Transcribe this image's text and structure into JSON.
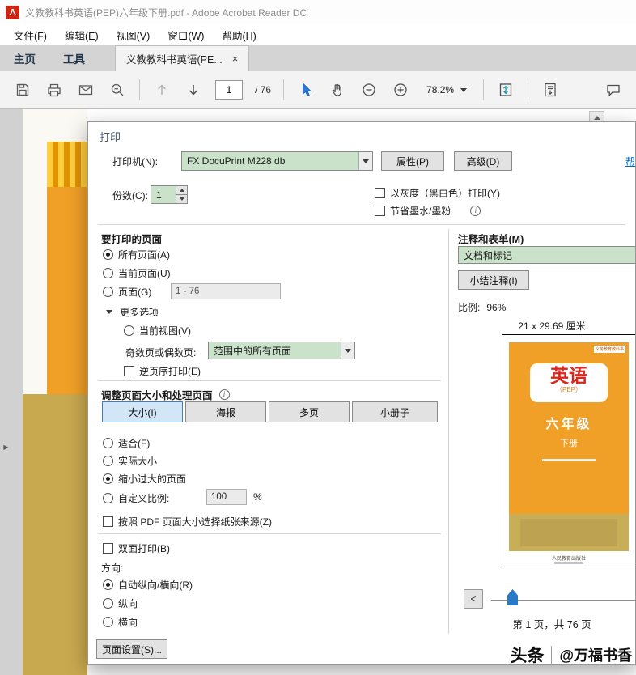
{
  "title_bar": {
    "app_title": "义教教科书英语(PEP)六年级下册.pdf - Adobe Acrobat Reader DC"
  },
  "menu_bar": {
    "items": [
      "文件(F)",
      "编辑(E)",
      "视图(V)",
      "窗口(W)",
      "帮助(H)"
    ]
  },
  "tab_bar": {
    "home_tab": "主页",
    "tools_tab": "工具",
    "document_tab": "义教教科书英语(PE...",
    "close": "×"
  },
  "toolbar": {
    "page_current": "1",
    "page_total": "/ 76",
    "zoom_value": "78.2%"
  },
  "print_dialog": {
    "title": "打印",
    "printer": {
      "label": "打印机(N):",
      "value": "FX DocuPrint M228 db",
      "properties": "属性(P)",
      "advanced": "高级(D)",
      "help": "帮"
    },
    "copies": {
      "label": "份数(C):",
      "value": "1",
      "grayscale": "以灰度（黑白色）打印(Y)",
      "save_ink": "节省墨水/墨粉"
    },
    "pages": {
      "heading": "要打印的页面",
      "all": "所有页面(A)",
      "current": "当前页面(U)",
      "range": "页面(G)",
      "range_value": "1 - 76",
      "more": "更多选项",
      "current_view": "当前视图(V)",
      "odd_even_label": "奇数页或偶数页:",
      "odd_even_value": "范围中的所有页面",
      "reverse": "逆页序打印(E)"
    },
    "sizing": {
      "heading": "调整页面大小和处理页面",
      "buttons": [
        "大小(I)",
        "海报",
        "多页",
        "小册子"
      ],
      "fit": "适合(F)",
      "actual": "实际大小",
      "shrink": "缩小过大的页面",
      "custom": "自定义比例:",
      "custom_value": "100",
      "percent": "%",
      "paper_source": "按照 PDF 页面大小选择纸张来源(Z)"
    },
    "options": {
      "duplex": "双面打印(B)",
      "orientation_heading": "方向:",
      "auto": "自动纵向/横向(R)",
      "portrait": "纵向",
      "landscape": "横向"
    },
    "page_setup": "页面设置(S)...",
    "comments": {
      "heading": "注释和表单(M)",
      "value": "文档和标记",
      "summarize": "小结注释(I)"
    },
    "preview": {
      "scale_label": "比例:",
      "scale_value": "96%",
      "size_text": "21 x 29.69 厘米",
      "prev": "<",
      "page_info": "第 1 页，共 76 页"
    }
  },
  "book_cover": {
    "series": "义务教育教科书",
    "title": "英语",
    "edition": "（PEP）",
    "grade": "六年级",
    "volume": "下册",
    "publisher": "人民教育出版社"
  },
  "watermark": {
    "brand": "头条",
    "handle": "@万福书香"
  },
  "colors": {
    "accent_green": "#c9e2c9",
    "selected_blue": "#d3e6f8",
    "cover_orange": "#f0a026",
    "cover_tan": "#c9ae58",
    "link_blue": "#0563c1"
  }
}
